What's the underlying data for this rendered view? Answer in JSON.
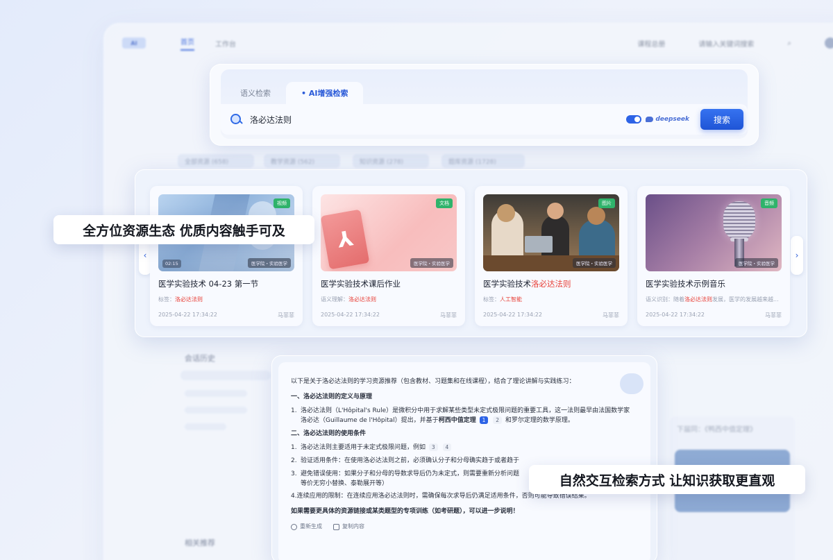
{
  "search": {
    "tabs": [
      {
        "label": "语义检索",
        "active": false
      },
      {
        "label": "AI增强检索",
        "active": true
      }
    ],
    "query": "洛必达法则",
    "deepseek_enabled": true,
    "deepseek_label": "deepseek",
    "button_label": "搜索"
  },
  "cards": [
    {
      "type": "视频",
      "type_color": "#2fb36b",
      "category": "医学院・实验医学",
      "duration": "02:15",
      "title_plain": "医学实验技术 04-23 第一节",
      "title_highlight": "",
      "meta_prefix": "标签：",
      "meta_highlight": "洛必达法则",
      "meta_suffix": "",
      "date": "2025-04-22 17:34:22",
      "author": "马菲菲",
      "thumb_icon": "lab-video-thumb"
    },
    {
      "type": "文档",
      "type_color": "#2fb36b",
      "category": "医学院・实验医学",
      "duration": "",
      "title_plain": "医学实验技术课后作业",
      "title_highlight": "",
      "meta_prefix": "语义理解：",
      "meta_highlight": "洛必达法则",
      "meta_suffix": "",
      "date": "2025-04-22 17:34:22",
      "author": "马菲菲",
      "thumb_icon": "pdf-doc-thumb"
    },
    {
      "type": "图片",
      "type_color": "#2fb36b",
      "category": "医学院・实验医学",
      "duration": "",
      "title_plain": "医学实验技术",
      "title_highlight": "洛必达法则",
      "meta_prefix": "标签：",
      "meta_highlight": "人工智能",
      "meta_suffix": "",
      "date": "2025-04-22 17:34:22",
      "author": "马菲菲",
      "thumb_icon": "group-photo-thumb"
    },
    {
      "type": "音频",
      "type_color": "#2fb36b",
      "category": "医学院・实验医学",
      "duration": "",
      "title_plain": "医学实验技术示例音乐",
      "title_highlight": "",
      "meta_prefix": "语义识别：随着",
      "meta_highlight": "洛必达法则",
      "meta_suffix": "发展，医学的发展越来越...",
      "date": "2025-04-22 17:34:22",
      "author": "马菲菲",
      "thumb_icon": "microphone-thumb"
    }
  ],
  "callouts": {
    "left": "全方位资源生态 优质内容触手可及",
    "right": "自然交互检索方式 让知识获取更直观"
  },
  "answer": {
    "intro": "以下是关于洛必达法则的学习资源推荐（包含教材、习题集和在线课程），结合了理论讲解与实践练习：",
    "section1_title": "一、洛必达法则的定义与原理",
    "s1_item1_a": "洛必达法则（L'Hôpital's Rule）是微积分中用于求解某些类型未定式极限问题的重要工具，这一法则最早由法国数学家",
    "s1_item1_b": "洛必达（Guillaume de l'Hôpital）提出，并基于",
    "s1_item1_bold": "柯西中值定理",
    "s1_ref1": "1",
    "s1_ref2": "2",
    "s1_item1_c": "和罗尔定理的数学原理。",
    "section2_title": "二、洛必达法则的使用条件",
    "s2_item1": "洛必达法则主要适用于未定式极限问题，例如",
    "s2_ref1": "3",
    "s2_ref2": "4",
    "s2_item2": "验证适用条件：在使用洛必达法则之前，必须确认分子和分母确实趋于或者趋于",
    "s2_item3_a": "避免错误使用：如果分子和分母的导数求导后仍为未定式，则需要重新分析问题",
    "s2_item3_b": "等价无穷小替换、泰勒展开等）",
    "s2_item4": "4.连续应用的限制：在连续应用洛必达法则时，需确保每次求导后仍满足适用条件，否则可能导致错误结果。",
    "closing": "如果需要更具体的资源链接或某类题型的专项训练（如考研题），可以进一步说明！",
    "regenerate": "重新生成",
    "copy": "复制内容"
  },
  "background": {
    "nav_home": "首页",
    "nav_workbench": "工作台",
    "nav_course": "课程总册",
    "search_hint": "请输入关键词搜索",
    "chips": [
      "全部资源 (658)",
      "教学资源 (562)",
      "知识资源 (278)",
      "题库资源 (1728)"
    ],
    "history_title": "会话历史",
    "related_title": "相关推荐",
    "side_title": "下届同：《鸭西中值定理》"
  }
}
